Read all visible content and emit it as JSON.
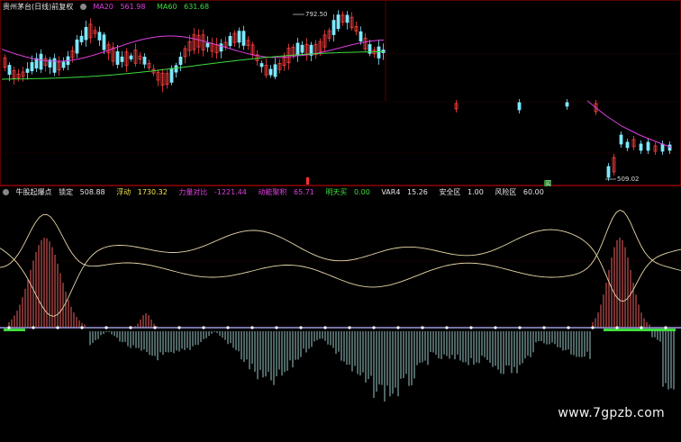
{
  "top_panel": {
    "name": "贵州茅台(日线)前复权",
    "indicators": [
      {
        "label": "MA20",
        "value": "561.98",
        "color": "#e040e0"
      },
      {
        "label": "MA60",
        "value": "631.68",
        "color": "#3ddc3d"
      }
    ],
    "annotations": {
      "high": "792.50",
      "low": "509.02",
      "marker": "买"
    }
  },
  "bottom_panel": {
    "name": "牛股起爆点",
    "fields": [
      {
        "label": "锁定",
        "value": "508.88",
        "color": "#e6e6e6"
      },
      {
        "label": "浮动",
        "value": "1730.32",
        "color": "#f2e34a"
      },
      {
        "label": "力量对比",
        "value": "-1221.44",
        "color": "#e040e0"
      },
      {
        "label": "动能聚积",
        "value": "65.71",
        "color": "#e040e0"
      },
      {
        "label": "明天买",
        "value": "0.00",
        "color": "#3ddc3d"
      },
      {
        "label": "VAR4",
        "value": "15.26",
        "color": "#e6e6e6"
      },
      {
        "label": "安全区",
        "value": "1.00",
        "color": "#e6e6e6"
      },
      {
        "label": "风险区",
        "value": "60.00",
        "color": "#e6e6e6"
      }
    ]
  },
  "watermark": "www.7gpzb.com",
  "chart_data": [
    {
      "type": "candlestick",
      "title": "贵州茅台(日线)前复权",
      "series": [
        {
          "name": "MA20",
          "color": "#e040e0"
        },
        {
          "name": "MA60",
          "color": "#3ddc3d"
        }
      ],
      "annotations": [
        "792.50",
        "509.02"
      ],
      "grid": true
    },
    {
      "type": "bar",
      "title": "牛股起爆点",
      "series": [
        {
          "name": "锁定",
          "value": 508.88
        },
        {
          "name": "浮动",
          "value": 1730.32
        },
        {
          "name": "力量对比",
          "value": -1221.44
        },
        {
          "name": "动能聚积",
          "value": 65.71
        },
        {
          "name": "明天买",
          "value": 0.0
        },
        {
          "name": "VAR4",
          "value": 15.26
        },
        {
          "name": "安全区",
          "value": 1.0
        },
        {
          "name": "风险区",
          "value": 60.0
        }
      ],
      "grid": true
    }
  ]
}
